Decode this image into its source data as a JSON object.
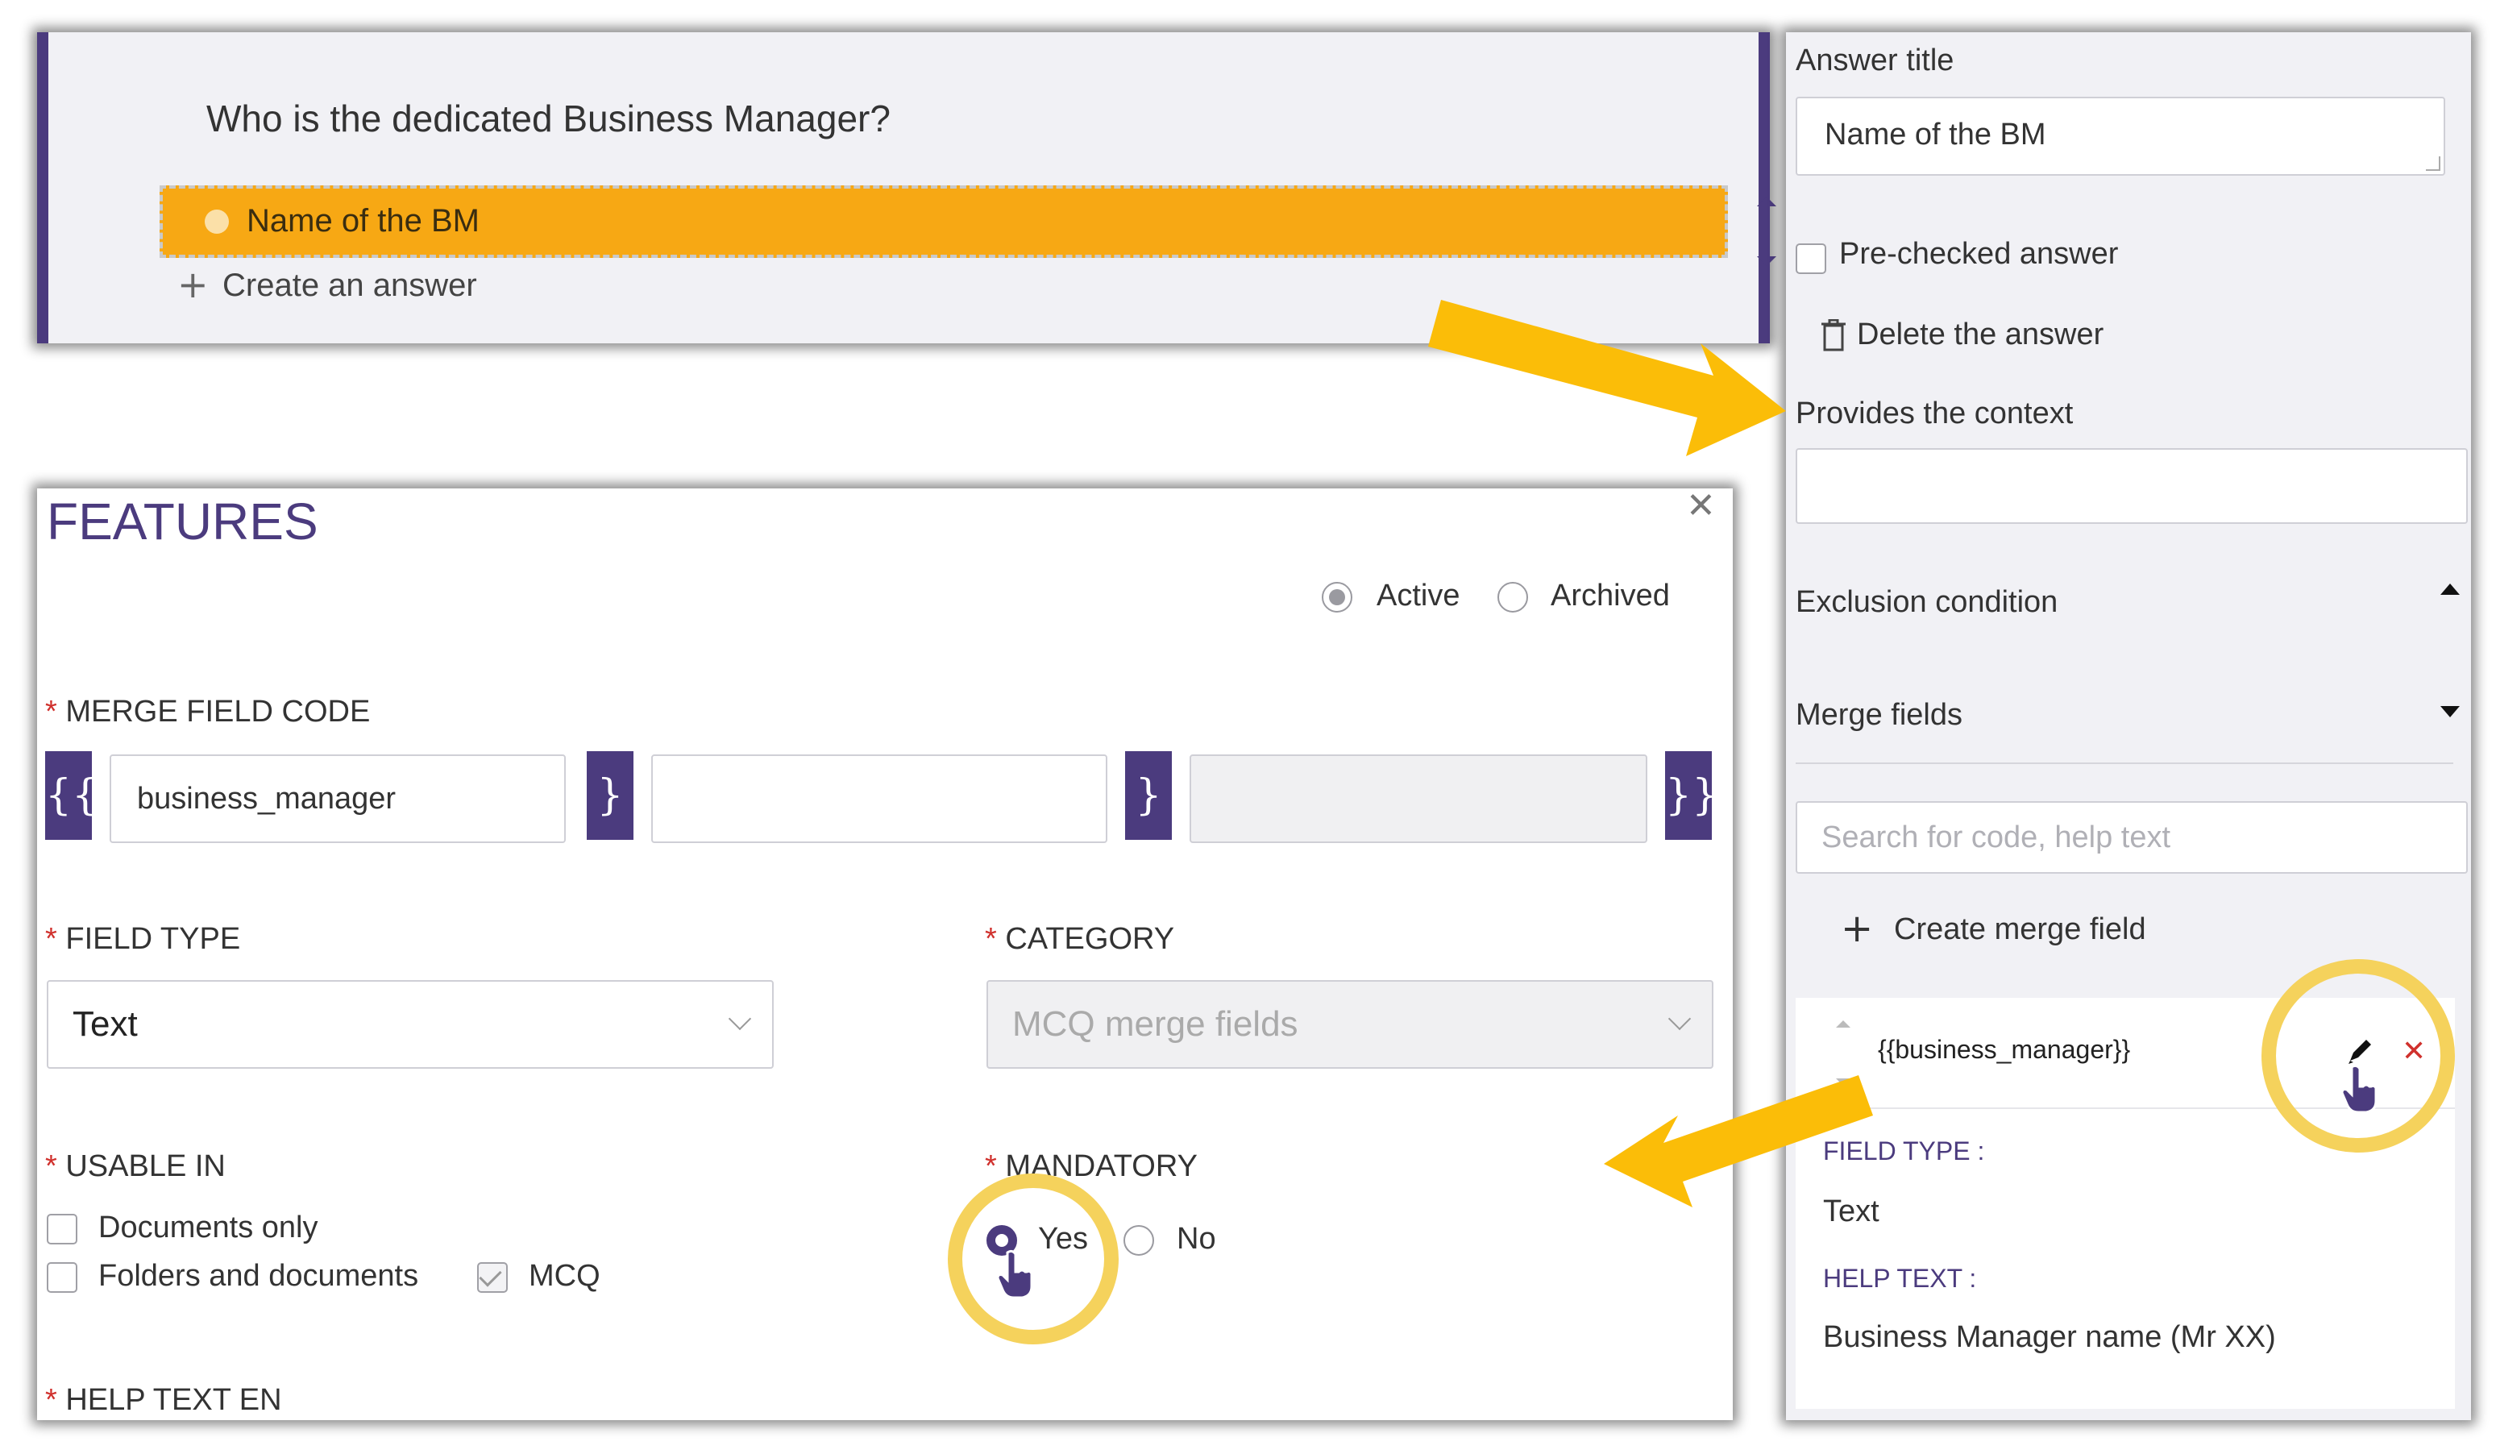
{
  "question": {
    "title": "Who is the dedicated Business Manager?",
    "answer": "Name of the BM",
    "create_answer": "Create an answer"
  },
  "answer_panel": {
    "answer_title_label": "Answer title",
    "answer_title_value": "Name of the BM",
    "prechecked_label": "Pre-checked answer",
    "delete_label": "Delete the answer",
    "context_label": "Provides the context",
    "exclusion_label": "Exclusion condition",
    "merge_fields_label": "Merge fields",
    "search_placeholder": "Search for code, help text",
    "create_merge_field": "Create merge field",
    "merge_item": {
      "code": "{{business_manager}}",
      "field_type_label": "FIELD TYPE :",
      "field_type_value": "Text",
      "help_text_label": "HELP TEXT :",
      "help_text_value": "Business Manager name (Mr XX)"
    }
  },
  "features": {
    "title": "FEATURES",
    "status_active": "Active",
    "status_archived": "Archived",
    "merge_code_label": "MERGE FIELD CODE",
    "brace_open": "{{",
    "brace_sep": "}{",
    "brace_close": "}}",
    "code_part1": "business_manager",
    "field_type_label": "FIELD TYPE",
    "field_type_value": "Text",
    "category_label": "CATEGORY",
    "category_value": "MCQ merge fields",
    "usable_in_label": "USABLE IN",
    "documents_only": "Documents only",
    "folders_and_documents": "Folders and documents",
    "mcq": "MCQ",
    "mandatory_label": "MANDATORY",
    "yes": "Yes",
    "no": "No",
    "help_text_label": "HELP TEXT EN",
    "required_mark": "*"
  },
  "colors": {
    "accent_purple": "#4b3b7e",
    "answer_orange": "#f7a814",
    "highlight_yellow": "#f5d25c",
    "arrow_yellow": "#fbbd08"
  }
}
